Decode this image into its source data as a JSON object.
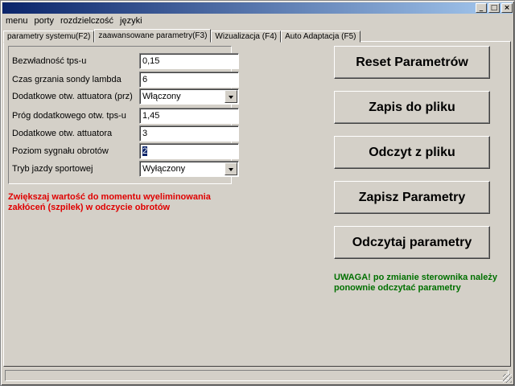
{
  "window": {
    "controls": {
      "minimize": "_",
      "maximize": "□",
      "close": "×"
    }
  },
  "menu": [
    "menu",
    "porty",
    "rozdzielczość",
    "języki"
  ],
  "tabs": [
    {
      "label": "parametry systemu(F2)",
      "active": false
    },
    {
      "label": "zaawansowane parametry(F3)",
      "active": true
    },
    {
      "label": "Wizualizacja (F4)",
      "active": false
    },
    {
      "label": "Auto Adaptacja (F5)",
      "active": false
    }
  ],
  "params": [
    {
      "label": "Bezwładność tps-u",
      "value": "0,15",
      "type": "text"
    },
    {
      "label": "Czas grzania sondy lambda",
      "value": "6",
      "type": "text"
    },
    {
      "label": "Dodatkowe otw. attuatora (prz)",
      "value": "Włączony",
      "type": "select"
    },
    {
      "label": "Próg dodatkowego otw. tps-u",
      "value": "1,45",
      "type": "text"
    },
    {
      "label": "Dodatkowe otw. attuatora",
      "value": "3",
      "type": "text"
    },
    {
      "label": "Poziom sygnału obrotów",
      "value": "2",
      "type": "text",
      "selected": true
    },
    {
      "label": "Tryb jazdy sportowej",
      "value": "Wyłączony",
      "type": "select"
    }
  ],
  "hint_red": "Zwiększaj wartość do momentu wyeliminowania zakłóceń (szpilek) w odczycie obrotów",
  "buttons": {
    "reset": "Reset Parametrów",
    "save_file": "Zapis do pliku",
    "read_file": "Odczyt z pliku",
    "save_params": "Zapisz Parametry",
    "read_params": "Odczytaj parametry"
  },
  "hint_green": "UWAGA! po zmianie sterownika należy ponownie odczytać parametry",
  "colors": {
    "title_start": "#0a246a",
    "title_end": "#a6caf0",
    "warning_red": "#e00000",
    "warning_green": "#007000",
    "face": "#d4d0c8"
  }
}
